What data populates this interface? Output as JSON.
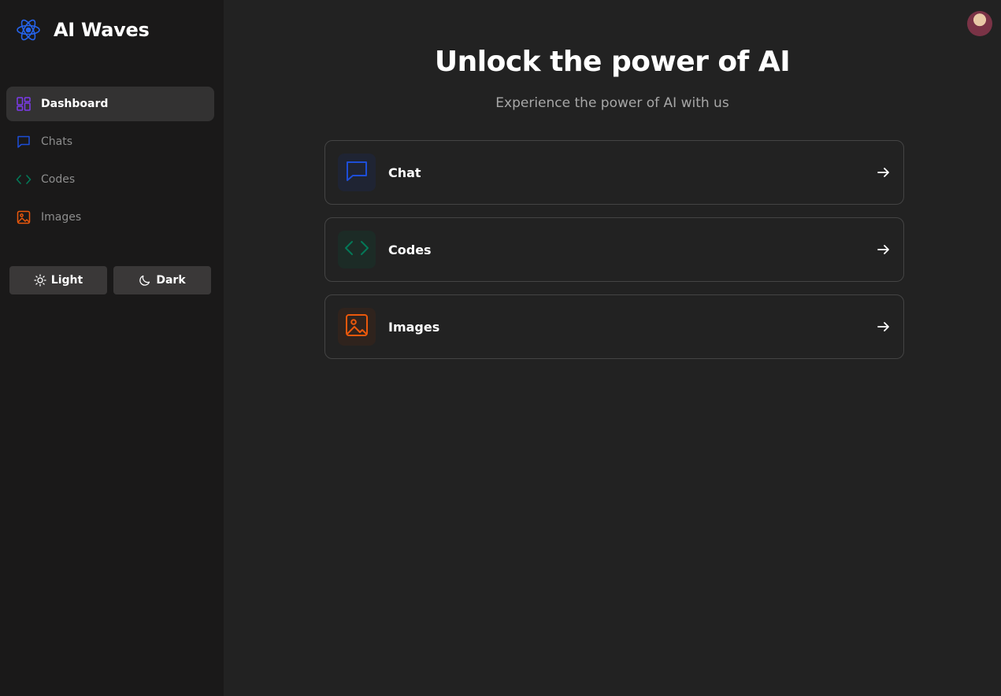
{
  "sidebar": {
    "brand": {
      "title": "AI Waves",
      "icon": "atom-icon",
      "color": "#2563eb"
    },
    "nav": [
      {
        "label": "Dashboard",
        "icon": "grid-icon",
        "color": "#7c3aed",
        "active": true
      },
      {
        "label": "Chats",
        "icon": "chat-bubble-icon",
        "color": "#1d4ed8"
      },
      {
        "label": "Codes",
        "icon": "code-icon",
        "color": "#047857"
      },
      {
        "label": "Images",
        "icon": "image-icon",
        "color": "#ea580c"
      }
    ],
    "theme": {
      "light_label": "Light",
      "dark_label": "Dark"
    }
  },
  "header": {
    "avatar": "user-avatar"
  },
  "main": {
    "title": "Unlock the power of AI",
    "subtitle": "Experience the power of AI with us",
    "cards": [
      {
        "label": "Chat",
        "icon": "chat-bubble-icon",
        "color": "#1d4ed8",
        "tile_bg": "#1f2433"
      },
      {
        "label": "Codes",
        "icon": "code-icon",
        "color": "#047857",
        "tile_bg": "#1c2b26"
      },
      {
        "label": "Images",
        "icon": "image-icon",
        "color": "#ea580c",
        "tile_bg": "#2f231d"
      }
    ]
  }
}
